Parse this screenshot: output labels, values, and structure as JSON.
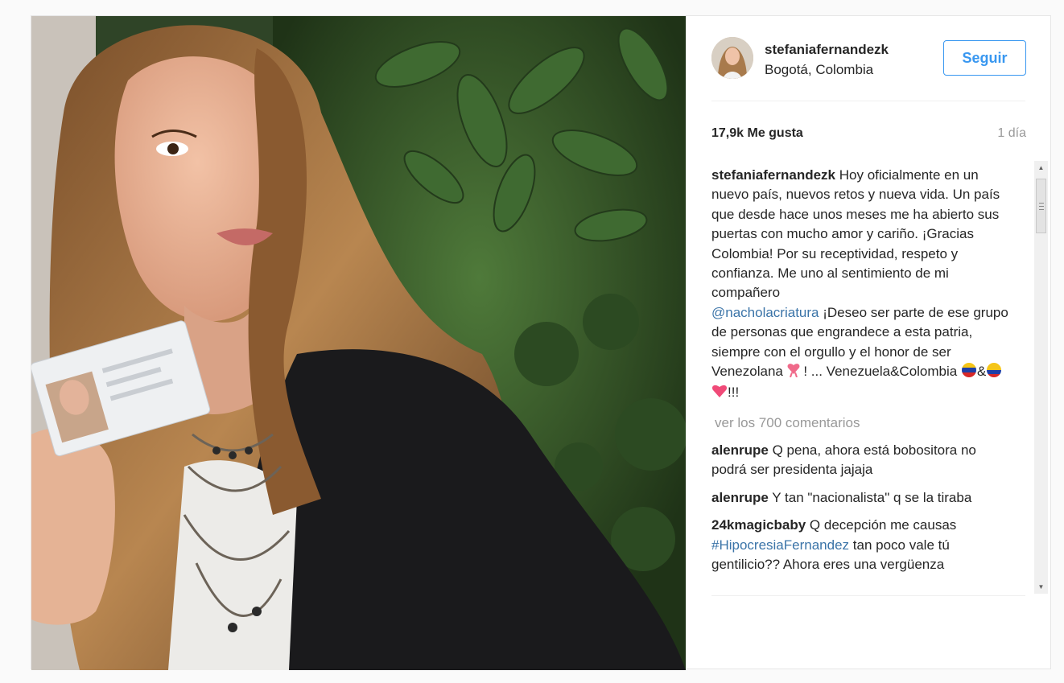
{
  "post": {
    "username": "stefaniafernandezk",
    "location": "Bogotá, Colombia",
    "follow_label": "Seguir",
    "likes": "17,9k Me gusta",
    "time": "1 día",
    "caption": {
      "username": "stefaniafernandezk",
      "text_1": "Hoy oficialmente en un nuevo país, nuevos retos y nueva vida. Un país que desde hace unos meses me ha abierto sus puertas con mucho amor y cariño. ¡Gracias Colombia! Por su receptividad, respeto y confianza. Me uno al sentimiento de mi compañero",
      "mention": "@nacholacriatura",
      "text_2": "¡Deseo ser parte de ese grupo de personas que engrandece a esta patria, siempre con el orgullo y el honor de ser Venezolana",
      "text_3": "! ... Venezuela&Colombia",
      "text_4": "&",
      "text_5": "!!!"
    },
    "view_more": "ver los 700 comentarios",
    "comments": [
      {
        "username": "alenrupe",
        "text": "Q pena, ahora está bobositora no podrá ser presidenta jajaja"
      },
      {
        "username": "alenrupe",
        "text": "Y tan \"nacionalista\" q se la tiraba"
      },
      {
        "username": "24kmagicbaby",
        "text": "Q decepción me causas",
        "mention": "#HipocresiaFernandez",
        "text_2": "tan poco vale tú gentilicio?? Ahora eres una vergüenza"
      }
    ]
  },
  "icons": {
    "scroll_up": "triangle-up",
    "scroll_down": "triangle-down"
  },
  "colors": {
    "accent": "#3897f0",
    "mention": "#3b74a8",
    "muted": "#999999"
  }
}
